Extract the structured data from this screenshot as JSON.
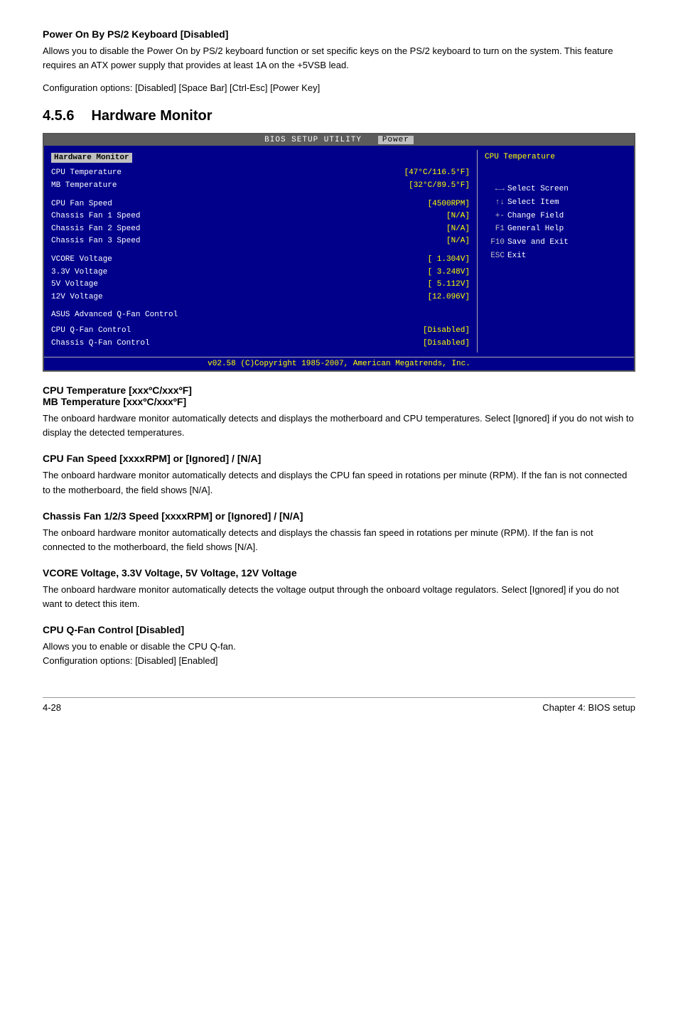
{
  "top_section": {
    "title": "Power On By PS/2 Keyboard [Disabled]",
    "body1": "Allows you to disable the Power On by PS/2 keyboard function or set specific keys on the PS/2 keyboard to turn on the system. This feature requires an ATX power supply that provides at least 1A on the +5VSB lead.",
    "body2": "Configuration options: [Disabled] [Space Bar] [Ctrl-Esc] [Power Key]"
  },
  "hw_section": {
    "num": "4.5.6",
    "label": "Hardware Monitor"
  },
  "bios": {
    "title": "BIOS SETUP UTILITY",
    "tab": "Power",
    "left_header": "Hardware Monitor",
    "rows": [
      {
        "label": "CPU Temperature",
        "value": "[47°C/116.5°F]"
      },
      {
        "label": "MB Temperature",
        "value": "[32°C/89.5°F]"
      }
    ],
    "fan_rows": [
      {
        "label": "CPU Fan Speed",
        "value": "[4500RPM]"
      },
      {
        "label": "Chassis Fan 1 Speed",
        "value": "[N/A]"
      },
      {
        "label": "Chassis Fan 2 Speed",
        "value": "[N/A]"
      },
      {
        "label": "Chassis Fan 3 Speed",
        "value": "[N/A]"
      }
    ],
    "voltage_rows": [
      {
        "label": "VCORE Voltage",
        "value": "[ 1.304V]"
      },
      {
        "label": "3.3V  Voltage",
        "value": "[ 3.248V]"
      },
      {
        "label": "5V    Voltage",
        "value": "[ 5.112V]"
      },
      {
        "label": "12V   Voltage",
        "value": "[12.096V]"
      }
    ],
    "advanced_label": "ASUS Advanced Q-Fan Control",
    "qfan_rows": [
      {
        "label": "CPU Q-Fan Control",
        "value": "[Disabled]"
      },
      {
        "label": "Chassis Q-Fan Control",
        "value": "[Disabled]"
      }
    ],
    "right_title": "CPU Temperature",
    "keys": [
      {
        "sym": "←→",
        "desc": "Select Screen"
      },
      {
        "sym": "↑↓",
        "desc": "Select Item"
      },
      {
        "sym": "+-",
        "desc": "Change Field"
      },
      {
        "sym": "F1",
        "desc": "General Help"
      },
      {
        "sym": "F10",
        "desc": "Save and Exit"
      },
      {
        "sym": "ESC",
        "desc": "Exit"
      }
    ],
    "footer": "v02.58 (C)Copyright 1985-2007, American Megatrends, Inc."
  },
  "sections": [
    {
      "title": "CPU Temperature [xxxºC/xxxºF]\nMB Temperature [xxxºC/xxxºF]",
      "body": "The onboard hardware monitor automatically detects and displays the motherboard and CPU temperatures. Select [Ignored] if you do not wish to display the detected temperatures."
    },
    {
      "title": "CPU Fan Speed [xxxxRPM] or [Ignored] / [N/A]",
      "body": "The onboard hardware monitor automatically detects and displays the CPU fan speed in rotations per minute (RPM). If the fan is not connected to the motherboard, the field shows [N/A]."
    },
    {
      "title": "Chassis Fan 1/2/3 Speed [xxxxRPM] or [Ignored] / [N/A]",
      "body": "The onboard hardware monitor automatically detects and displays the chassis fan speed in rotations per minute (RPM). If the fan is not connected to the motherboard, the field shows [N/A]."
    },
    {
      "title": "VCORE Voltage, 3.3V Voltage, 5V Voltage, 12V Voltage",
      "body": "The onboard hardware monitor automatically detects the voltage output through the onboard voltage regulators. Select [Ignored] if you do not want to detect this item."
    },
    {
      "title": "CPU Q-Fan Control [Disabled]",
      "body": "Allows you to enable or disable the CPU Q-fan.\nConfiguration options: [Disabled] [Enabled]"
    }
  ],
  "footer": {
    "left": "4-28",
    "right": "Chapter 4: BIOS setup"
  }
}
